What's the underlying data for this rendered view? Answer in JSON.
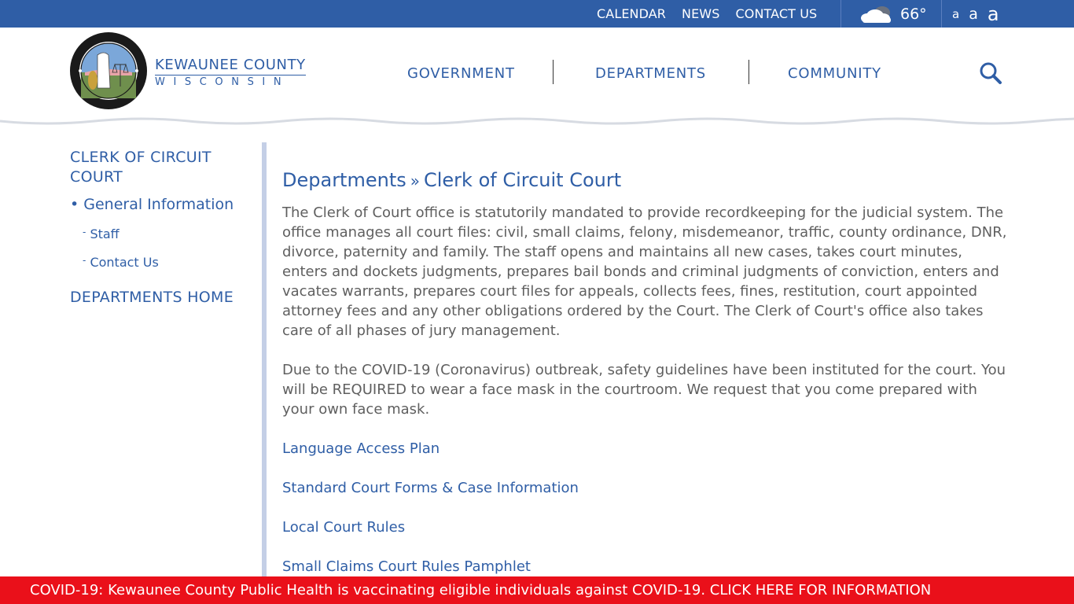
{
  "topbar": {
    "links": [
      "CALENDAR",
      "NEWS",
      "CONTACT US"
    ],
    "weather": {
      "icon": "cloudy-icon",
      "temperature": "66°"
    },
    "font_sizes": [
      "a",
      "a",
      "a"
    ]
  },
  "header": {
    "seal_text": "COUNTY SEAL OF KEWAUNEE COUNTY · STATE OF WISCONSIN",
    "county_name": "KEWAUNEE COUNTY",
    "state_name": "WISCONSIN",
    "nav": [
      "GOVERNMENT",
      "DEPARTMENTS",
      "COMMUNITY"
    ],
    "search_icon": "search-icon"
  },
  "sidebar": {
    "title": "CLERK OF CIRCUIT COURT",
    "active_item": "General Information",
    "sub_items": [
      "Staff",
      "Contact Us"
    ],
    "home_link": "DEPARTMENTS HOME"
  },
  "main": {
    "breadcrumb": {
      "parent": "Departments",
      "separator": "»",
      "current": "Clerk of Circuit Court"
    },
    "paragraphs": [
      "The Clerk of Court office is statutorily mandated to provide recordkeeping for the judicial system. The office manages all court files: civil, small claims, felony, misdemeanor, traffic, county ordinance, DNR, divorce, paternity and family. The staff opens and maintains all new cases, takes court minutes, enters and dockets judgments, prepares bail bonds and criminal judgments of conviction, enters and vacates warrants, prepares court files for appeals, collects fees, fines, restitution, court appointed attorney fees and any other obligations ordered by the Court. The Clerk of Court's office also takes care of all phases of jury management.",
      "Due to the COVID-19 (Coronavirus) outbreak, safety guidelines have been instituted for the court. You will be REQUIRED to wear a face mask in the courtroom. We request that you come prepared with your own face mask."
    ],
    "links": [
      "Language Access Plan",
      "Standard Court Forms & Case Information",
      "Local Court Rules",
      "Small Claims Court Rules Pamphlet"
    ]
  },
  "alert": {
    "text": "COVID-19: Kewaunee County Public Health is vaccinating eligible individuals against COVID-19. CLICK HERE FOR INFORMATION"
  },
  "colors": {
    "brand_blue": "#2f5ea6",
    "body_text": "#5f5f5f",
    "alert_red": "#ea101a",
    "sidebar_rule": "#c4cfe6"
  }
}
